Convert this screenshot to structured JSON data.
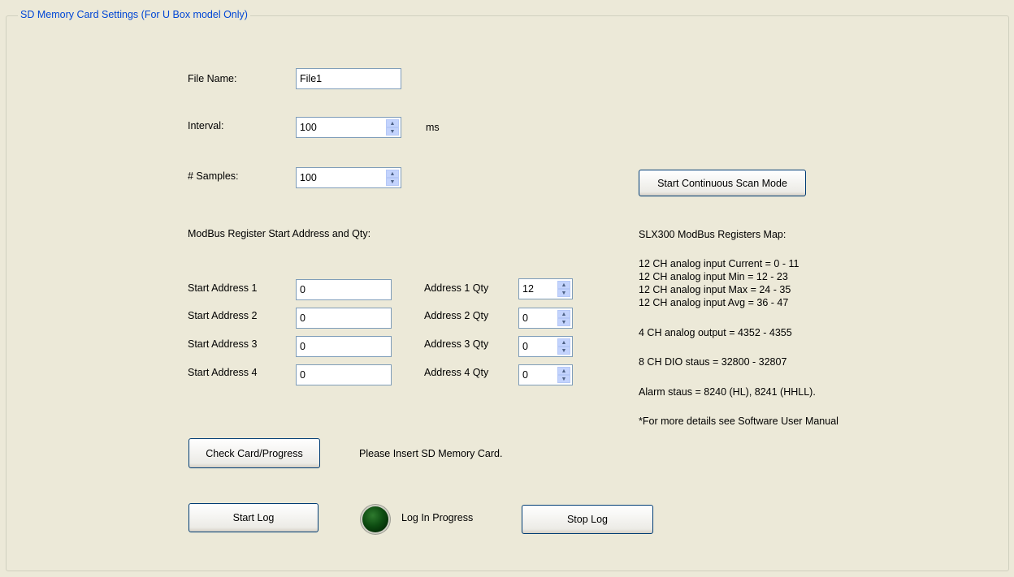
{
  "group": {
    "title": "SD Memory Card Settings (For U Box model Only)"
  },
  "file_name": {
    "label": "File Name:",
    "value": "File1"
  },
  "interval": {
    "label": "Interval:",
    "value": "100",
    "unit": "ms"
  },
  "samples": {
    "label": "# Samples:",
    "value": "100"
  },
  "continuous_scan_button": "Start Continuous Scan Mode",
  "modbus": {
    "heading": "ModBus Register Start Address and Qty:",
    "rows": [
      {
        "start_label": "Start Address 1",
        "start_value": "0",
        "qty_label": "Address 1 Qty",
        "qty_value": "12"
      },
      {
        "start_label": "Start Address 2",
        "start_value": "0",
        "qty_label": "Address 2 Qty",
        "qty_value": "0"
      },
      {
        "start_label": "Start Address 3",
        "start_value": "0",
        "qty_label": "Address 3 Qty",
        "qty_value": "0"
      },
      {
        "start_label": "Start Address 4",
        "start_value": "0",
        "qty_label": "Address 4 Qty",
        "qty_value": "0"
      }
    ]
  },
  "register_map": {
    "heading": "SLX300 ModBus Registers Map:",
    "analog_input": [
      "12 CH analog input Current = 0 - 11",
      "12 CH analog input Min = 12 - 23",
      "12 CH analog input Max = 24 - 35",
      "12 CH analog input Avg = 36 - 47"
    ],
    "analog_output": "4 CH analog output = 4352 - 4355",
    "dio": "8 CH DIO staus = 32800 - 32807",
    "alarm": "Alarm staus = 8240 (HL), 8241 (HHLL).",
    "note": "*For more details see Software User Manual"
  },
  "check_card_button": "Check Card/Progress",
  "card_status": "Please Insert SD Memory Card.",
  "start_log_button": "Start Log",
  "log_indicator_label": "Log In Progress",
  "stop_log_button": "Stop Log",
  "icons": {
    "spin_up": "spin-up-arrow",
    "spin_down": "spin-down-arrow",
    "led": "status-led"
  },
  "colors": {
    "background": "#ECE9D8",
    "title": "#0046D5",
    "led": "#0E4D12"
  }
}
